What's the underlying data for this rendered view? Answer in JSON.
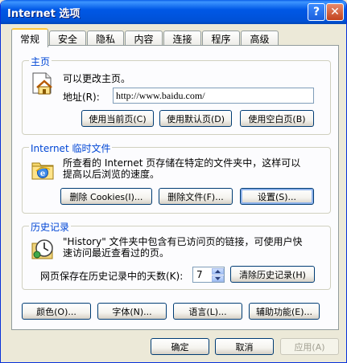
{
  "window": {
    "title": "Internet 选项",
    "help_glyph": "?",
    "close_glyph": "✕"
  },
  "tabs": [
    {
      "label": "常规",
      "active": true
    },
    {
      "label": "安全",
      "active": false
    },
    {
      "label": "隐私",
      "active": false
    },
    {
      "label": "内容",
      "active": false
    },
    {
      "label": "连接",
      "active": false
    },
    {
      "label": "程序",
      "active": false
    },
    {
      "label": "高级",
      "active": false
    }
  ],
  "home_page": {
    "title": "主页",
    "icon": "home-page-icon",
    "description": "可以更改主页。",
    "address_label": "地址(R):",
    "address_value": "http://www.baidu.com/",
    "buttons": {
      "use_current": "使用当前页(C)",
      "use_default": "使用默认页(D)",
      "use_blank": "使用空白页(B)"
    }
  },
  "temp_files": {
    "title": "Internet 临时文件",
    "icon": "temporary-internet-files-icon",
    "description_line1": "所查看的 Internet 页存储在特定的文件夹中，这样可以",
    "description_line2": "提高以后浏览的速度。",
    "buttons": {
      "delete_cookies": "删除 Cookies(I)...",
      "delete_files": "删除文件(F)...",
      "settings": "设置(S)..."
    }
  },
  "history": {
    "title": "历史记录",
    "icon": "history-icon",
    "description_line1": "\"History\" 文件夹中包含有已访问页的链接，可使用户快",
    "description_line2": "速访问最近查看过的页。",
    "days_label": "网页保存在历史记录中的天数(K):",
    "days_value": "7",
    "clear_button": "清除历史记录(H)"
  },
  "bottom_buttons": {
    "colors": "颜色(O)...",
    "fonts": "字体(N)...",
    "languages": "语言(L)...",
    "accessibility": "辅助功能(E)..."
  },
  "dialog_buttons": {
    "ok": "确定",
    "cancel": "取消",
    "apply": "应用(A)"
  },
  "colors": {
    "title_bar": "#0054e3",
    "group_title": "#0046d5",
    "tab_highlight": "#ffc83c"
  }
}
